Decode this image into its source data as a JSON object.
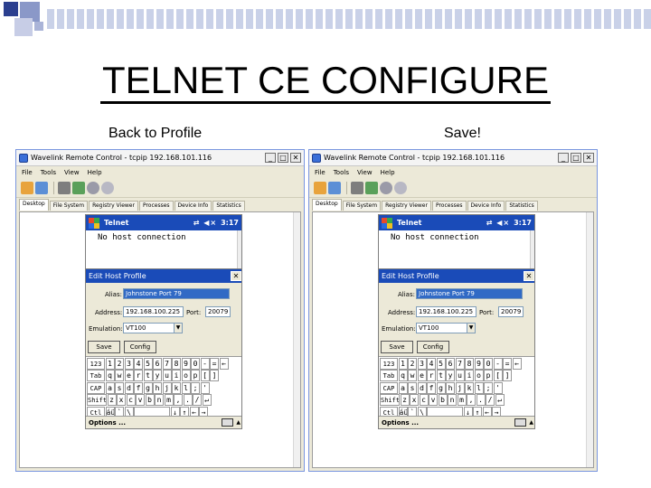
{
  "slide": {
    "title": "TELNET CE CONFIGURE",
    "left_caption": "Back to Profile",
    "right_caption": "Save!"
  },
  "window": {
    "title": "Wavelink Remote Control - tcpip 192.168.101.116",
    "buttons": {
      "minimize": "_",
      "maximize": "□",
      "close": "✕"
    },
    "menu": [
      "File",
      "Tools",
      "View",
      "Help"
    ],
    "tabs": [
      "Desktop",
      "File System",
      "Registry Viewer",
      "Processes",
      "Device Info",
      "Statistics"
    ],
    "toolbar_icons": [
      "open-icon",
      "save-icon",
      "device-icon",
      "refresh-icon",
      "zoom-in-icon",
      "zoom-out-icon"
    ]
  },
  "device": {
    "app_title": "Telnet",
    "status_icons": "⇄ ◀×",
    "time": "3:17",
    "terminal_text": "No host connection",
    "dialog": {
      "title": "Edit Host Profile",
      "close": "✕",
      "alias_label": "Alias:",
      "alias_value": "Johnstone Port 79",
      "address_label": "Address:",
      "address_value": "192.168.100.225",
      "port_label": "Port:",
      "port_value": "20079",
      "emulation_label": "Emulation:",
      "emulation_value": "VT100",
      "save_label": "Save",
      "config_label": "Config"
    },
    "keyboard": {
      "rows": [
        [
          "123",
          "1",
          "2",
          "3",
          "4",
          "5",
          "6",
          "7",
          "8",
          "9",
          "0",
          "-",
          "=",
          "←"
        ],
        [
          "Tab",
          "q",
          "w",
          "e",
          "r",
          "t",
          "y",
          "u",
          "i",
          "o",
          "p",
          "[",
          "]"
        ],
        [
          "CAP",
          "a",
          "s",
          "d",
          "f",
          "g",
          "h",
          "j",
          "k",
          "l",
          ";",
          "'"
        ],
        [
          "Shift",
          "z",
          "x",
          "c",
          "v",
          "b",
          "n",
          "m",
          ",",
          ".",
          "/",
          "↵"
        ],
        [
          "Ctl",
          "áü",
          "`",
          "\\",
          " ",
          "↓",
          "↑",
          "←",
          "→"
        ]
      ]
    },
    "options_label": "Options ...",
    "kbd_arrow": "▲"
  },
  "colors": {
    "title_blue": "#1a4bb8",
    "window_face": "#ece9d8"
  }
}
